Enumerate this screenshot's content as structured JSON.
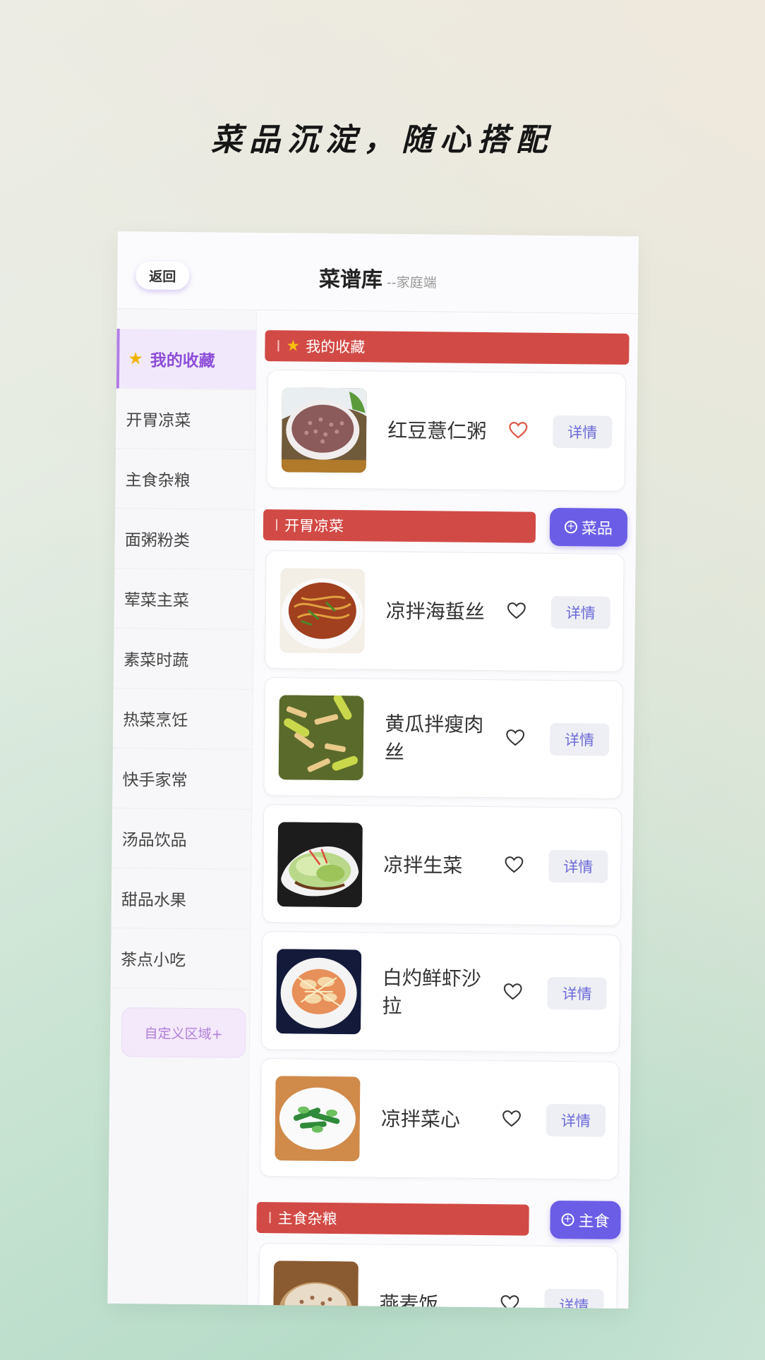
{
  "tagline": "菜品沉淀，随心搭配",
  "header": {
    "back_label": "返回",
    "title": "菜谱库",
    "subtitle": "--家庭端"
  },
  "sidebar": {
    "items": [
      {
        "label": "我的收藏",
        "active": true
      },
      {
        "label": "开胃凉菜"
      },
      {
        "label": "主食杂粮"
      },
      {
        "label": "面粥粉类"
      },
      {
        "label": "荤菜主菜"
      },
      {
        "label": "素菜时蔬"
      },
      {
        "label": "热菜烹饪"
      },
      {
        "label": "快手家常"
      },
      {
        "label": "汤品饮品"
      },
      {
        "label": "甜品水果"
      },
      {
        "label": "茶点小吃"
      }
    ],
    "custom_label": "自定义区域+"
  },
  "sections": {
    "favorites": {
      "title": "我的收藏",
      "items": [
        {
          "name": "红豆薏仁粥",
          "favorited": true,
          "detail": "详情"
        }
      ]
    },
    "cold_dishes": {
      "title": "开胃凉菜",
      "add_label": "菜品",
      "items": [
        {
          "name": "凉拌海蜇丝",
          "detail": "详情"
        },
        {
          "name": "黄瓜拌瘦肉丝",
          "detail": "详情"
        },
        {
          "name": "凉拌生菜",
          "detail": "详情"
        },
        {
          "name": "白灼鲜虾沙拉",
          "detail": "详情"
        },
        {
          "name": "凉拌菜心",
          "detail": "详情"
        }
      ]
    },
    "staples": {
      "title": "主食杂粮",
      "add_label": "主食",
      "items": [
        {
          "name": "燕麦饭",
          "detail": "详情"
        }
      ]
    }
  },
  "colors": {
    "accent_purple": "#6b5de6",
    "section_red": "#d24a45",
    "active_side": "#8d4dd8",
    "heart_fav": "#e05a4a"
  }
}
